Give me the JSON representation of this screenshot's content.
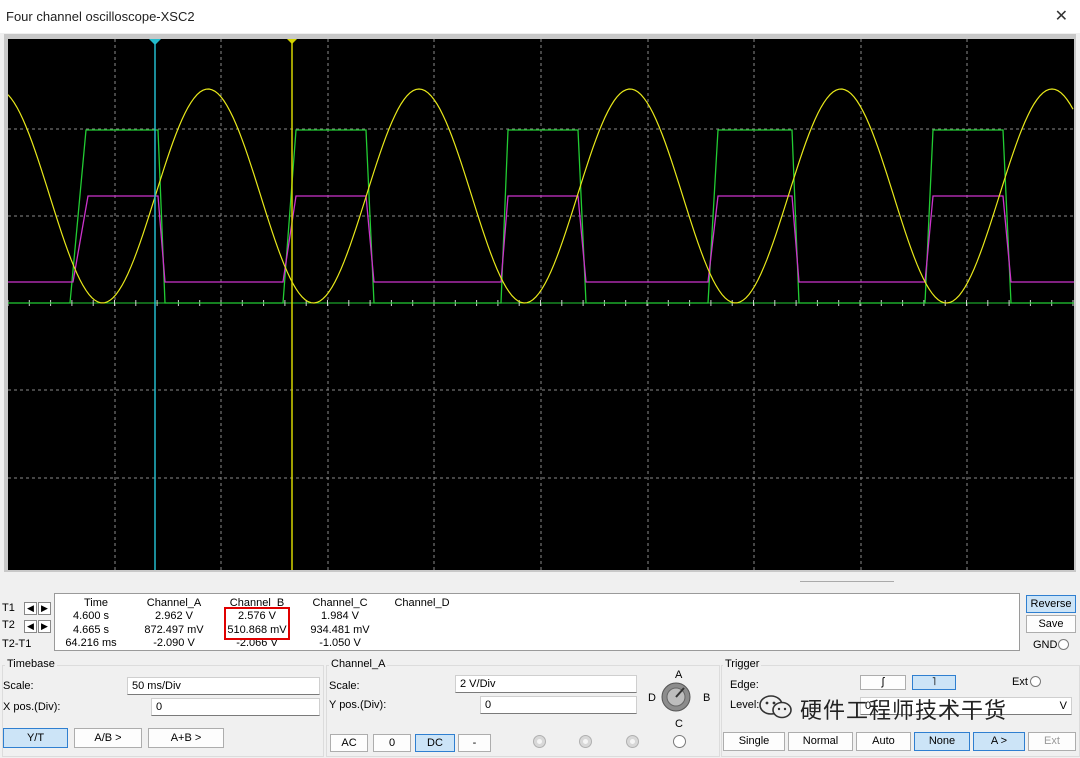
{
  "window": {
    "title": "Four channel oscilloscope-XSC2"
  },
  "icons": {
    "close": "close-icon",
    "knob": "channel-selector-knob-icon",
    "wechat": "wechat-icon"
  },
  "colors": {
    "channel_a": "#ffff33",
    "channel_b": "#cc33cc",
    "channel_c": "#22cc33",
    "cursor_t1": "#22bbcc",
    "cursor_t2": "#d4d400",
    "highlight": "#e00000"
  },
  "readout": {
    "headers": {
      "time": "Time",
      "a": "Channel_A",
      "b": "Channel_B",
      "c": "Channel_C",
      "d": "Channel_D"
    },
    "rows": [
      {
        "label": "T1",
        "time": "4.600 s",
        "a": "2.962 V",
        "b": "2.576 V",
        "c": "1.984 V",
        "d": ""
      },
      {
        "label": "T2",
        "time": "4.665 s",
        "a": "872.497 mV",
        "b": "510.868 mV",
        "c": "934.481 mV",
        "d": ""
      },
      {
        "label": "T2-T1",
        "time": "64.216 ms",
        "a": "-2.090 V",
        "b": "-2.066 V",
        "c": "-1.050 V",
        "d": ""
      }
    ]
  },
  "side_buttons": {
    "reverse": "Reverse",
    "save": "Save",
    "gnd": "GND"
  },
  "timebase": {
    "title": "Timebase",
    "scale_label": "Scale:",
    "scale_value": "50 ms/Div",
    "xpos_label": "X pos.(Div):",
    "xpos_value": "0",
    "modes": [
      "Y/T",
      "A/B >",
      "A+B >"
    ],
    "active_mode": "Y/T"
  },
  "channel": {
    "title": "Channel_A",
    "scale_label": "Scale:",
    "scale_value": "2  V/Div",
    "ypos_label": "Y pos.(Div):",
    "ypos_value": "0",
    "coupling": [
      "AC",
      "0",
      "DC",
      "-"
    ],
    "active_coupling": "DC",
    "knob_labels": {
      "a": "A",
      "b": "B",
      "c": "C",
      "d": "D"
    }
  },
  "trigger": {
    "title": "Trigger",
    "edge_label": "Edge:",
    "edge_rising": "ʃ",
    "edge_falling": "˥",
    "ext_label": "Ext",
    "level_label": "Level:",
    "level_value": "0",
    "level_unit": "V",
    "modes": [
      "Single",
      "Normal",
      "Auto",
      "None"
    ],
    "active_mode": "None",
    "source_a": "A >",
    "source_ext": "Ext"
  },
  "watermark": "硬件工程师技术干货",
  "scope_display": {
    "cursor_t1_time_s": 4.6,
    "cursor_t2_time_s": 4.665,
    "volts_per_div": 2,
    "time_per_div_ms": 50
  }
}
